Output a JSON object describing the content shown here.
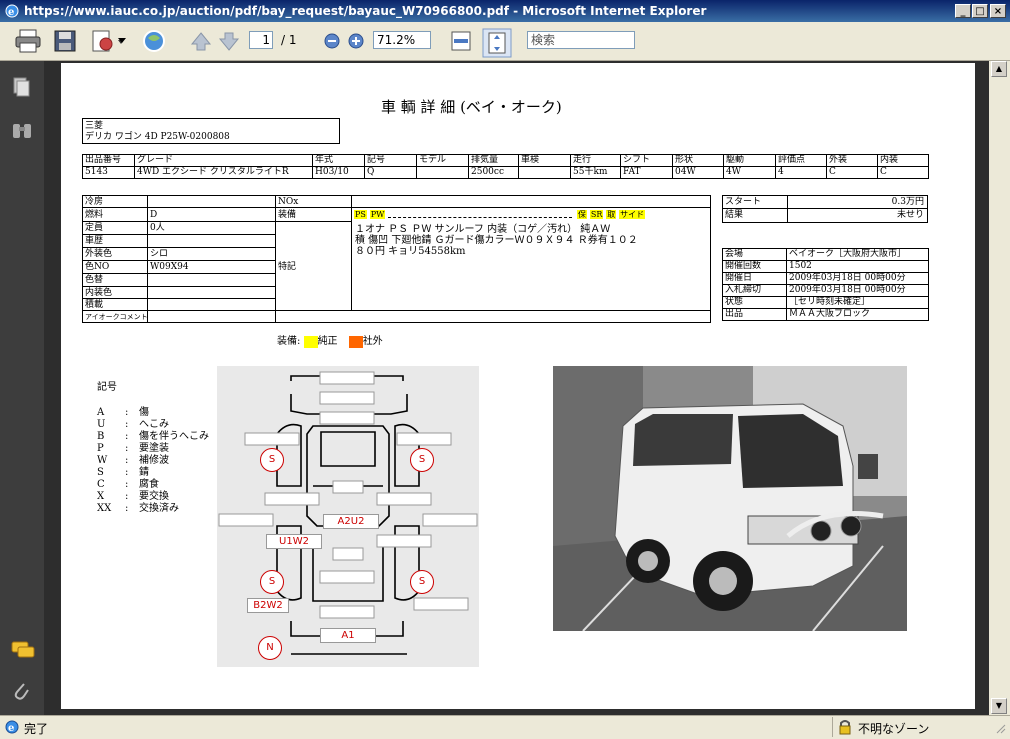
{
  "window": {
    "title": "https://www.iauc.co.jp/auction/pdf/bay_request/bayauc_W70966800.pdf - Microsoft Internet Explorer",
    "min": "_",
    "max": "□",
    "close": "×"
  },
  "toolbar": {
    "page_current": "1",
    "page_total": "/ 1",
    "zoom": "71.2%",
    "search_placeholder": "検索"
  },
  "status": {
    "left": "完了",
    "right": "不明なゾーン"
  },
  "doc": {
    "title": "車 輌 詳 細 (ベイ・オーク)",
    "maker": "三菱",
    "model": "デリカ ワゴン 4D P25W-0200808",
    "row1_headers": [
      "出品番号",
      "グレード",
      "年式",
      "記号",
      "モデル",
      "排気量",
      "車検",
      "走行",
      "シフト",
      "形状",
      "駆動",
      "評価点",
      "外装",
      "内装"
    ],
    "row1_values": [
      "5143",
      "4WD エクシード クリスタルライトR",
      "H03/10",
      "Q",
      "",
      "2500cc",
      "",
      "55千km",
      "FAT",
      "04W",
      "4W",
      "4",
      "C",
      "C"
    ],
    "spec": {
      "labels": [
        "冷房",
        "燃料",
        "定員",
        "車歴",
        "外装色",
        "色NO",
        "色替",
        "内装色",
        "積載",
        "アイオークコメント"
      ],
      "values": [
        "",
        "D",
        "0人",
        "",
        "シロ",
        "W09X94",
        "",
        "",
        "",
        ""
      ],
      "nox_label": "NOx",
      "equip_label": "装備",
      "note_label": "特記",
      "equip_tags_left": [
        "PS",
        "PW"
      ],
      "equip_tags_right": [
        "保",
        "SR",
        "取",
        "サイド"
      ],
      "note_lines": [
        "１オナ ＰＳ ＰＷ サンルーフ 内装（コゲ／汚れ） 純ＡＷ",
        "積 傷凹 下廻他錆 Ｇガード傷カラーＷ０９Ｘ９４ Ｒ券有１０２",
        "８０円 キョリ54558km"
      ]
    },
    "start": {
      "label": "スタート",
      "value": "0.3万円",
      "result_label": "結果",
      "result_value": "未せり"
    },
    "auction": {
      "labels": [
        "会場",
        "開催回数",
        "開催日",
        "入札締切",
        "状態",
        "出品"
      ],
      "values": [
        "ベイオーク［大阪府大阪市］",
        "1502",
        "2009年03月18日 00時00分",
        "2009年03月18日 00時00分",
        "［セリ時刻未確定］",
        "ＭＡＡ大阪ブロック"
      ]
    },
    "legend": {
      "label": "装備:",
      "genuine": "純正",
      "aftermarket": "社外",
      "genuine_color": "#ffff00",
      "after_color": "#ff6600"
    },
    "key": {
      "title": "記号",
      "items": [
        {
          "code": "A",
          "desc": "傷"
        },
        {
          "code": "U",
          "desc": "へこみ"
        },
        {
          "code": "B",
          "desc": "傷を伴うへこみ"
        },
        {
          "code": "P",
          "desc": "要塗装"
        },
        {
          "code": "W",
          "desc": "補修波"
        },
        {
          "code": "S",
          "desc": "錆"
        },
        {
          "code": "C",
          "desc": "腐食"
        },
        {
          "code": "X",
          "desc": "要交換"
        },
        {
          "code": "XX",
          "desc": "交換済み"
        }
      ]
    },
    "diagram": {
      "marks": [
        "S",
        "S",
        "A2U2",
        "U1W2",
        "S",
        "S",
        "B2W2",
        "A1",
        "N"
      ]
    }
  }
}
